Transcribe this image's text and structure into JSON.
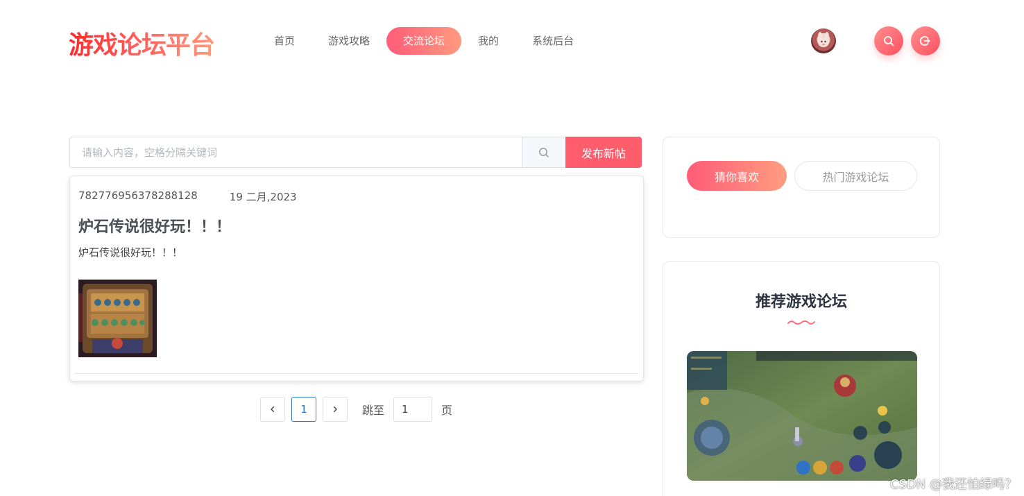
{
  "header": {
    "logo": "游戏论坛平台",
    "nav": [
      {
        "label": "首页"
      },
      {
        "label": "游戏攻略"
      },
      {
        "label": "交流论坛",
        "active": true
      },
      {
        "label": "我的"
      },
      {
        "label": "系统后台"
      }
    ]
  },
  "search": {
    "placeholder": "请输入内容，空格分隔关键词",
    "value": "",
    "publish_label": "发布新帖"
  },
  "post": {
    "author_id": "782776956378288128",
    "date": "19 二月,2023",
    "title": "炉石传说很好玩！！！",
    "content": "炉石传说很好玩！！！"
  },
  "pagination": {
    "current": "1",
    "jump_label": "跳至",
    "jump_value": "1",
    "page_suffix": "页"
  },
  "sidebar": {
    "tabs": [
      {
        "label": "猜你喜欢",
        "active": true
      },
      {
        "label": "热门游戏论坛",
        "active": false
      }
    ],
    "recommend_title": "推荐游戏论坛"
  },
  "watermark": "CSDN @我还怕绿吗？",
  "colors": {
    "accent": "#ff5c6c",
    "accent_gradient_start": "#ff5c78",
    "accent_gradient_end": "#ff9d80",
    "link_blue": "#2f79c7"
  },
  "icons": {
    "search": "search-icon",
    "logout": "logout-icon",
    "prev": "chevron-left-icon",
    "next": "chevron-right-icon"
  }
}
